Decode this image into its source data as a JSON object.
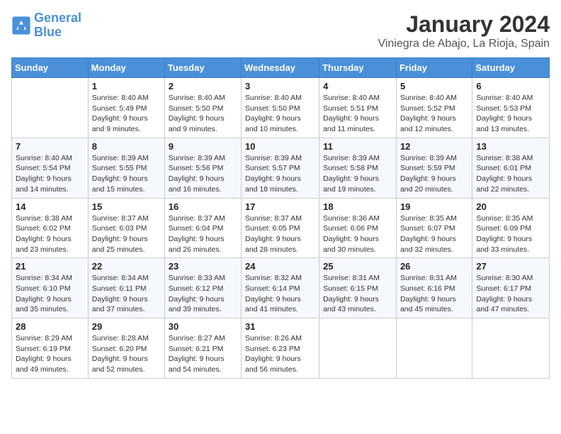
{
  "logo": {
    "line1": "General",
    "line2": "Blue"
  },
  "title": "January 2024",
  "subtitle": "Viniegra de Abajo, La Rioja, Spain",
  "headers": [
    "Sunday",
    "Monday",
    "Tuesday",
    "Wednesday",
    "Thursday",
    "Friday",
    "Saturday"
  ],
  "weeks": [
    [
      null,
      {
        "day": "1",
        "sunrise": "8:40 AM",
        "sunset": "5:49 PM",
        "daylight": "9 hours and 9 minutes."
      },
      {
        "day": "2",
        "sunrise": "8:40 AM",
        "sunset": "5:50 PM",
        "daylight": "9 hours and 9 minutes."
      },
      {
        "day": "3",
        "sunrise": "8:40 AM",
        "sunset": "5:50 PM",
        "daylight": "9 hours and 10 minutes."
      },
      {
        "day": "4",
        "sunrise": "8:40 AM",
        "sunset": "5:51 PM",
        "daylight": "9 hours and 11 minutes."
      },
      {
        "day": "5",
        "sunrise": "8:40 AM",
        "sunset": "5:52 PM",
        "daylight": "9 hours and 12 minutes."
      },
      {
        "day": "6",
        "sunrise": "8:40 AM",
        "sunset": "5:53 PM",
        "daylight": "9 hours and 13 minutes."
      }
    ],
    [
      {
        "day": "7",
        "sunrise": "8:40 AM",
        "sunset": "5:54 PM",
        "daylight": "9 hours and 14 minutes."
      },
      {
        "day": "8",
        "sunrise": "8:39 AM",
        "sunset": "5:55 PM",
        "daylight": "9 hours and 15 minutes."
      },
      {
        "day": "9",
        "sunrise": "8:39 AM",
        "sunset": "5:56 PM",
        "daylight": "9 hours and 16 minutes."
      },
      {
        "day": "10",
        "sunrise": "8:39 AM",
        "sunset": "5:57 PM",
        "daylight": "9 hours and 18 minutes."
      },
      {
        "day": "11",
        "sunrise": "8:39 AM",
        "sunset": "5:58 PM",
        "daylight": "9 hours and 19 minutes."
      },
      {
        "day": "12",
        "sunrise": "8:39 AM",
        "sunset": "5:59 PM",
        "daylight": "9 hours and 20 minutes."
      },
      {
        "day": "13",
        "sunrise": "8:38 AM",
        "sunset": "6:01 PM",
        "daylight": "9 hours and 22 minutes."
      }
    ],
    [
      {
        "day": "14",
        "sunrise": "8:38 AM",
        "sunset": "6:02 PM",
        "daylight": "9 hours and 23 minutes."
      },
      {
        "day": "15",
        "sunrise": "8:37 AM",
        "sunset": "6:03 PM",
        "daylight": "9 hours and 25 minutes."
      },
      {
        "day": "16",
        "sunrise": "8:37 AM",
        "sunset": "6:04 PM",
        "daylight": "9 hours and 26 minutes."
      },
      {
        "day": "17",
        "sunrise": "8:37 AM",
        "sunset": "6:05 PM",
        "daylight": "9 hours and 28 minutes."
      },
      {
        "day": "18",
        "sunrise": "8:36 AM",
        "sunset": "6:06 PM",
        "daylight": "9 hours and 30 minutes."
      },
      {
        "day": "19",
        "sunrise": "8:35 AM",
        "sunset": "6:07 PM",
        "daylight": "9 hours and 32 minutes."
      },
      {
        "day": "20",
        "sunrise": "8:35 AM",
        "sunset": "6:09 PM",
        "daylight": "9 hours and 33 minutes."
      }
    ],
    [
      {
        "day": "21",
        "sunrise": "8:34 AM",
        "sunset": "6:10 PM",
        "daylight": "9 hours and 35 minutes."
      },
      {
        "day": "22",
        "sunrise": "8:34 AM",
        "sunset": "6:11 PM",
        "daylight": "9 hours and 37 minutes."
      },
      {
        "day": "23",
        "sunrise": "8:33 AM",
        "sunset": "6:12 PM",
        "daylight": "9 hours and 39 minutes."
      },
      {
        "day": "24",
        "sunrise": "8:32 AM",
        "sunset": "6:14 PM",
        "daylight": "9 hours and 41 minutes."
      },
      {
        "day": "25",
        "sunrise": "8:31 AM",
        "sunset": "6:15 PM",
        "daylight": "9 hours and 43 minutes."
      },
      {
        "day": "26",
        "sunrise": "8:31 AM",
        "sunset": "6:16 PM",
        "daylight": "9 hours and 45 minutes."
      },
      {
        "day": "27",
        "sunrise": "8:30 AM",
        "sunset": "6:17 PM",
        "daylight": "9 hours and 47 minutes."
      }
    ],
    [
      {
        "day": "28",
        "sunrise": "8:29 AM",
        "sunset": "6:19 PM",
        "daylight": "9 hours and 49 minutes."
      },
      {
        "day": "29",
        "sunrise": "8:28 AM",
        "sunset": "6:20 PM",
        "daylight": "9 hours and 52 minutes."
      },
      {
        "day": "30",
        "sunrise": "8:27 AM",
        "sunset": "6:21 PM",
        "daylight": "9 hours and 54 minutes."
      },
      {
        "day": "31",
        "sunrise": "8:26 AM",
        "sunset": "6:23 PM",
        "daylight": "9 hours and 56 minutes."
      },
      null,
      null,
      null
    ]
  ]
}
